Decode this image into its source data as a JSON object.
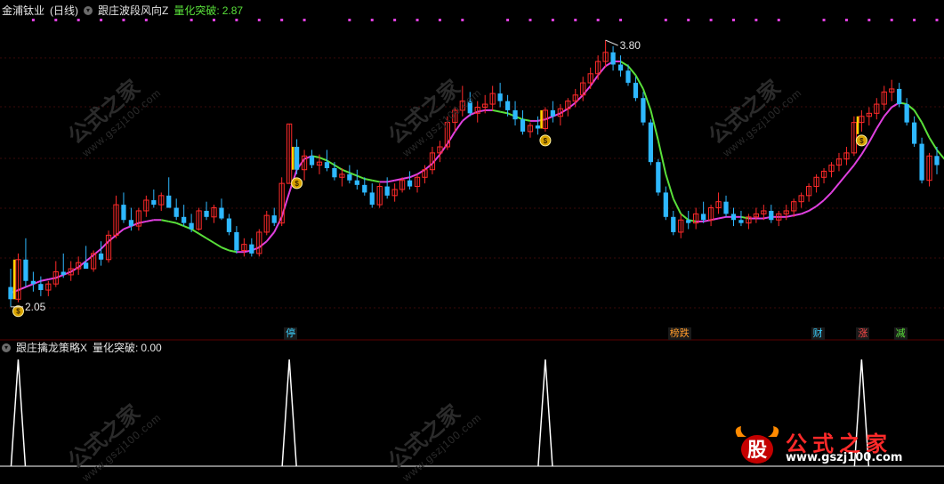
{
  "main_header": {
    "symbol": "金浦钛业",
    "period": "(日线)",
    "indicator": "跟庄波段风向Z",
    "metric_label": "量化突破:",
    "metric_value": "2.87"
  },
  "sub_header": {
    "indicator": "跟庄擒龙策略X",
    "metric_label": "量化突破:",
    "metric_value": "0.00"
  },
  "colors": {
    "background": "#000000",
    "up": "#ff2a2a",
    "down": "#2eb8ff",
    "line_up": "#e040e0",
    "line_down": "#59e03a",
    "dot": "#e040e0",
    "signal": "#ffd400",
    "grid": "#3a0a0a"
  },
  "watermark": {
    "text": "公式之家",
    "sub": "www.gszj100.com"
  },
  "logo": {
    "brand": "公式之家",
    "url": "www.gszj100.com",
    "icon": "bull-logo-icon"
  },
  "chart_data": [
    {
      "type": "candlestick",
      "title": "跟庄波段风向Z",
      "annotations": {
        "high_label": "3.80",
        "low_label": "2.05"
      },
      "signal_markers": {
        "icon": "money-bag-icon",
        "x": [
          1,
          38,
          71,
          113
        ]
      },
      "tags": [
        {
          "text": "停",
          "x": 37,
          "color": "#3ad1ff"
        },
        {
          "text": "榜跌",
          "x": 88,
          "color": "#ff9b2a"
        },
        {
          "text": "财",
          "x": 107,
          "color": "#3ad1ff"
        },
        {
          "text": "涨",
          "x": 113,
          "color": "#ff4a4a"
        },
        {
          "text": "减",
          "x": 118,
          "color": "#59e03a"
        }
      ],
      "ohlc": [
        [
          2.18,
          2.3,
          2.05,
          2.1
        ],
        [
          2.1,
          2.4,
          2.08,
          2.36
        ],
        [
          2.36,
          2.5,
          2.18,
          2.22
        ],
        [
          2.22,
          2.28,
          2.15,
          2.2
        ],
        [
          2.2,
          2.25,
          2.12,
          2.16
        ],
        [
          2.16,
          2.22,
          2.12,
          2.2
        ],
        [
          2.2,
          2.35,
          2.18,
          2.28
        ],
        [
          2.28,
          2.4,
          2.24,
          2.26
        ],
        [
          2.26,
          2.35,
          2.22,
          2.3
        ],
        [
          2.3,
          2.38,
          2.26,
          2.34
        ],
        [
          2.34,
          2.45,
          2.3,
          2.3
        ],
        [
          2.3,
          2.42,
          2.28,
          2.4
        ],
        [
          2.4,
          2.48,
          2.32,
          2.36
        ],
        [
          2.36,
          2.55,
          2.34,
          2.52
        ],
        [
          2.52,
          2.78,
          2.5,
          2.72
        ],
        [
          2.72,
          2.8,
          2.6,
          2.62
        ],
        [
          2.62,
          2.7,
          2.55,
          2.58
        ],
        [
          2.58,
          2.7,
          2.55,
          2.68
        ],
        [
          2.68,
          2.78,
          2.64,
          2.75
        ],
        [
          2.75,
          2.82,
          2.7,
          2.72
        ],
        [
          2.72,
          2.8,
          2.68,
          2.78
        ],
        [
          2.78,
          2.9,
          2.72,
          2.7
        ],
        [
          2.7,
          2.76,
          2.62,
          2.64
        ],
        [
          2.64,
          2.72,
          2.58,
          2.6
        ],
        [
          2.6,
          2.66,
          2.54,
          2.56
        ],
        [
          2.56,
          2.7,
          2.55,
          2.68
        ],
        [
          2.68,
          2.74,
          2.62,
          2.64
        ],
        [
          2.64,
          2.72,
          2.6,
          2.7
        ],
        [
          2.7,
          2.76,
          2.62,
          2.63
        ],
        [
          2.63,
          2.66,
          2.52,
          2.54
        ],
        [
          2.54,
          2.58,
          2.4,
          2.42
        ],
        [
          2.42,
          2.5,
          2.38,
          2.46
        ],
        [
          2.46,
          2.5,
          2.38,
          2.4
        ],
        [
          2.4,
          2.56,
          2.38,
          2.54
        ],
        [
          2.54,
          2.68,
          2.52,
          2.65
        ],
        [
          2.65,
          2.7,
          2.58,
          2.6
        ],
        [
          2.6,
          2.9,
          2.58,
          2.86
        ],
        [
          2.86,
          3.25,
          2.86,
          3.25
        ],
        [
          3.1,
          3.15,
          2.92,
          2.95
        ],
        [
          2.95,
          3.08,
          2.88,
          3.04
        ],
        [
          3.04,
          3.08,
          2.96,
          2.98
        ],
        [
          2.98,
          3.05,
          2.92,
          3.0
        ],
        [
          3.0,
          3.08,
          2.94,
          2.96
        ],
        [
          2.96,
          3.0,
          2.88,
          2.9
        ],
        [
          2.9,
          2.96,
          2.84,
          2.92
        ],
        [
          2.92,
          2.98,
          2.86,
          2.88
        ],
        [
          2.88,
          2.95,
          2.82,
          2.85
        ],
        [
          2.85,
          2.9,
          2.78,
          2.8
        ],
        [
          2.8,
          2.86,
          2.7,
          2.72
        ],
        [
          2.72,
          2.86,
          2.7,
          2.84
        ],
        [
          2.84,
          2.9,
          2.76,
          2.78
        ],
        [
          2.78,
          2.86,
          2.74,
          2.82
        ],
        [
          2.82,
          2.9,
          2.8,
          2.88
        ],
        [
          2.88,
          2.94,
          2.82,
          2.84
        ],
        [
          2.84,
          2.92,
          2.8,
          2.9
        ],
        [
          2.9,
          2.98,
          2.86,
          2.95
        ],
        [
          2.95,
          3.1,
          2.92,
          3.06
        ],
        [
          3.06,
          3.14,
          3.0,
          3.1
        ],
        [
          3.1,
          3.3,
          3.08,
          3.26
        ],
        [
          3.26,
          3.36,
          3.2,
          3.34
        ],
        [
          3.34,
          3.5,
          3.3,
          3.4
        ],
        [
          3.4,
          3.46,
          3.3,
          3.32
        ],
        [
          3.32,
          3.4,
          3.26,
          3.36
        ],
        [
          3.36,
          3.44,
          3.32,
          3.38
        ],
        [
          3.38,
          3.5,
          3.34,
          3.45
        ],
        [
          3.45,
          3.52,
          3.36,
          3.4
        ],
        [
          3.4,
          3.44,
          3.3,
          3.34
        ],
        [
          3.34,
          3.4,
          3.24,
          3.28
        ],
        [
          3.28,
          3.34,
          3.18,
          3.2
        ],
        [
          3.2,
          3.26,
          3.16,
          3.24
        ],
        [
          3.24,
          3.3,
          3.18,
          3.22
        ],
        [
          3.22,
          3.36,
          3.2,
          3.34
        ],
        [
          3.34,
          3.4,
          3.26,
          3.3
        ],
        [
          3.3,
          3.38,
          3.24,
          3.35
        ],
        [
          3.35,
          3.42,
          3.3,
          3.4
        ],
        [
          3.4,
          3.48,
          3.36,
          3.44
        ],
        [
          3.44,
          3.56,
          3.4,
          3.52
        ],
        [
          3.52,
          3.62,
          3.48,
          3.58
        ],
        [
          3.58,
          3.7,
          3.54,
          3.66
        ],
        [
          3.66,
          3.8,
          3.62,
          3.72
        ],
        [
          3.72,
          3.76,
          3.6,
          3.64
        ],
        [
          3.64,
          3.7,
          3.56,
          3.6
        ],
        [
          3.6,
          3.64,
          3.5,
          3.52
        ],
        [
          3.52,
          3.56,
          3.4,
          3.42
        ],
        [
          3.42,
          3.46,
          3.24,
          3.26
        ],
        [
          3.26,
          3.28,
          2.98,
          3.0
        ],
        [
          3.0,
          3.02,
          2.78,
          2.8
        ],
        [
          2.8,
          2.84,
          2.62,
          2.64
        ],
        [
          2.64,
          2.68,
          2.52,
          2.54
        ],
        [
          2.54,
          2.66,
          2.5,
          2.62
        ],
        [
          2.62,
          2.68,
          2.56,
          2.6
        ],
        [
          2.6,
          2.7,
          2.56,
          2.66
        ],
        [
          2.66,
          2.74,
          2.6,
          2.62
        ],
        [
          2.62,
          2.72,
          2.58,
          2.7
        ],
        [
          2.7,
          2.8,
          2.66,
          2.74
        ],
        [
          2.74,
          2.78,
          2.64,
          2.66
        ],
        [
          2.66,
          2.7,
          2.58,
          2.62
        ],
        [
          2.62,
          2.68,
          2.58,
          2.6
        ],
        [
          2.6,
          2.66,
          2.56,
          2.64
        ],
        [
          2.64,
          2.7,
          2.6,
          2.66
        ],
        [
          2.66,
          2.72,
          2.62,
          2.68
        ],
        [
          2.68,
          2.72,
          2.6,
          2.62
        ],
        [
          2.62,
          2.68,
          2.58,
          2.66
        ],
        [
          2.66,
          2.72,
          2.62,
          2.68
        ],
        [
          2.68,
          2.76,
          2.64,
          2.74
        ],
        [
          2.74,
          2.8,
          2.7,
          2.78
        ],
        [
          2.78,
          2.86,
          2.74,
          2.84
        ],
        [
          2.84,
          2.92,
          2.8,
          2.9
        ],
        [
          2.9,
          2.96,
          2.86,
          2.94
        ],
        [
          2.94,
          3.0,
          2.9,
          2.98
        ],
        [
          2.98,
          3.06,
          2.94,
          3.02
        ],
        [
          3.02,
          3.1,
          2.98,
          3.06
        ],
        [
          3.06,
          3.3,
          3.04,
          3.26
        ],
        [
          3.26,
          3.34,
          3.2,
          3.3
        ],
        [
          3.3,
          3.36,
          3.24,
          3.32
        ],
        [
          3.32,
          3.42,
          3.28,
          3.38
        ],
        [
          3.38,
          3.5,
          3.34,
          3.46
        ],
        [
          3.46,
          3.54,
          3.4,
          3.48
        ],
        [
          3.48,
          3.52,
          3.36,
          3.38
        ],
        [
          3.38,
          3.42,
          3.24,
          3.26
        ],
        [
          3.26,
          3.3,
          3.1,
          3.12
        ],
        [
          3.12,
          3.16,
          2.86,
          2.88
        ],
        [
          2.88,
          3.06,
          2.84,
          3.04
        ],
        [
          3.04,
          3.1,
          2.92,
          2.98
        ]
      ],
      "trend_line": [
        2.14,
        2.16,
        2.18,
        2.2,
        2.22,
        2.23,
        2.24,
        2.26,
        2.28,
        2.31,
        2.35,
        2.39,
        2.43,
        2.48,
        2.52,
        2.56,
        2.58,
        2.6,
        2.61,
        2.62,
        2.62,
        2.61,
        2.6,
        2.58,
        2.56,
        2.53,
        2.5,
        2.47,
        2.44,
        2.42,
        2.41,
        2.41,
        2.42,
        2.44,
        2.48,
        2.54,
        2.64,
        2.8,
        2.95,
        3.02,
        3.04,
        3.03,
        3.01,
        2.98,
        2.95,
        2.93,
        2.91,
        2.89,
        2.88,
        2.87,
        2.87,
        2.88,
        2.89,
        2.9,
        2.92,
        2.95,
        2.99,
        3.05,
        3.12,
        3.2,
        3.27,
        3.31,
        3.33,
        3.34,
        3.34,
        3.33,
        3.32,
        3.3,
        3.28,
        3.27,
        3.27,
        3.28,
        3.3,
        3.32,
        3.35,
        3.39,
        3.44,
        3.5,
        3.57,
        3.63,
        3.66,
        3.66,
        3.63,
        3.57,
        3.48,
        3.34,
        3.14,
        2.92,
        2.76,
        2.66,
        2.62,
        2.61,
        2.61,
        2.62,
        2.63,
        2.64,
        2.64,
        2.64,
        2.63,
        2.63,
        2.63,
        2.64,
        2.64,
        2.64,
        2.65,
        2.66,
        2.68,
        2.71,
        2.75,
        2.8,
        2.86,
        2.92,
        2.98,
        3.05,
        3.13,
        3.22,
        3.3,
        3.36,
        3.39,
        3.38,
        3.34,
        3.26,
        3.16,
        3.08,
        3.02
      ]
    },
    {
      "type": "line",
      "title": "跟庄擒龙策略X",
      "series": [
        {
          "name": "量化突破",
          "spikes_at": [
            1,
            37,
            71,
            113
          ]
        }
      ]
    }
  ]
}
